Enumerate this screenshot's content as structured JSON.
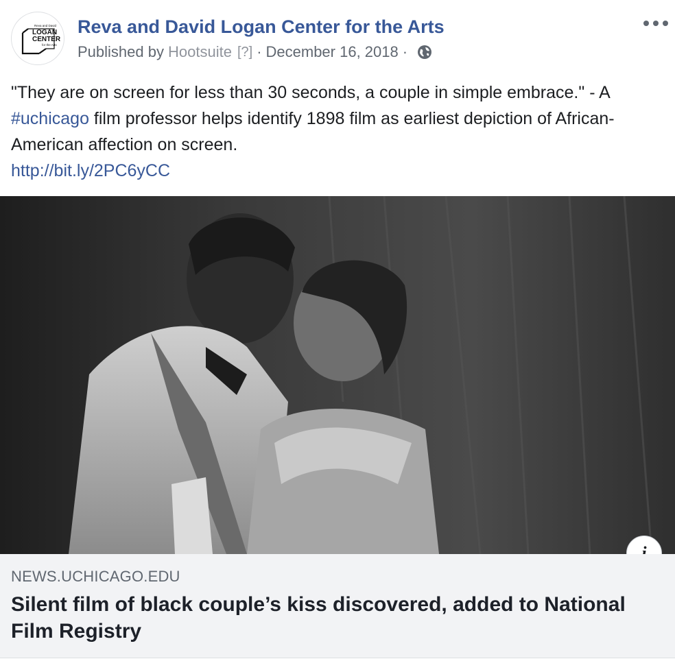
{
  "post": {
    "page_name": "Reva and David Logan Center for the Arts",
    "avatar_logo_text": [
      "Reva and David",
      "LOGAN",
      "CENTER",
      "for the Arts"
    ],
    "byline": {
      "published_by": "Published by",
      "tool": "Hootsuite",
      "help": "[?]",
      "separator": "·",
      "date": "December 16, 2018",
      "audience_icon": "globe-icon"
    },
    "more_icon": "ellipsis-icon",
    "message": {
      "part1": "\"They are on screen for less than 30 seconds, a couple in simple embrace.\" - A ",
      "hashtag": "#uchicago",
      "part2": " film professor helps identify 1898 film as earliest depiction of African-American affection on screen.",
      "link": "http://bit.ly/2PC6yCC"
    }
  },
  "link_preview": {
    "image_description": "black and white film still of a couple kissing",
    "info_label": "i",
    "domain": "NEWS.UCHICAGO.EDU",
    "title": "Silent film of black couple’s kiss discovered, added to National Film Registry"
  },
  "colors": {
    "link": "#385898",
    "secondary_text": "#606770",
    "preview_bg": "#f2f3f5"
  }
}
